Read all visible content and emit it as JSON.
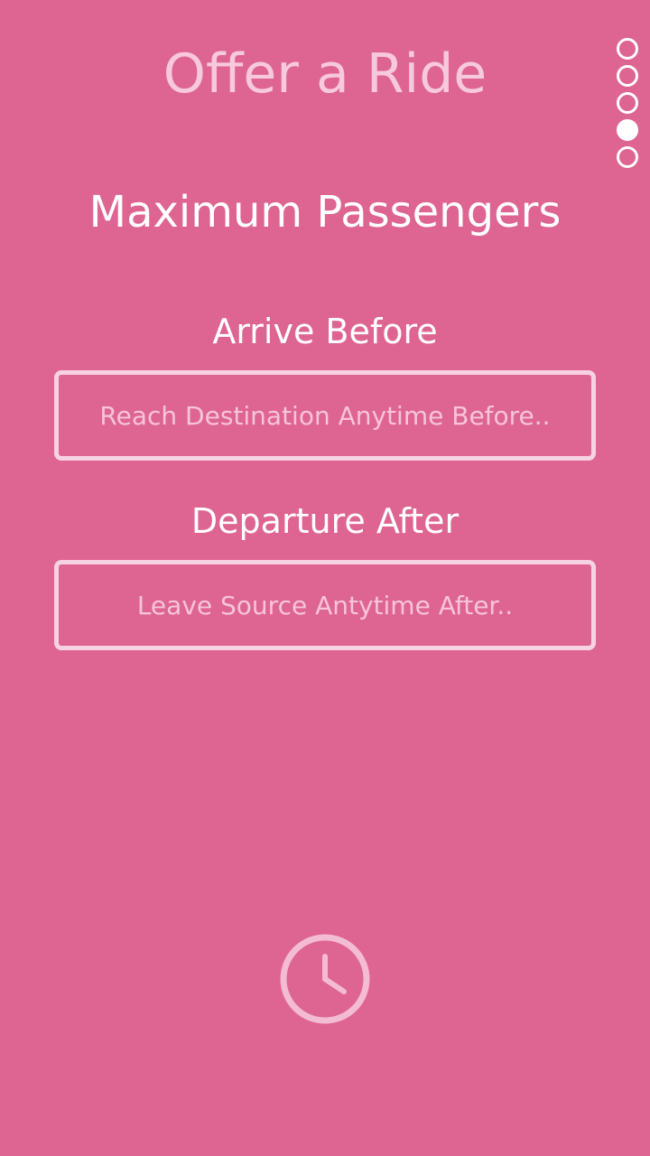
{
  "header": {
    "title": "Offer a Ride"
  },
  "pager": {
    "total": 5,
    "active_index": 3
  },
  "form": {
    "section_title": "Maximum Passengers",
    "arrive": {
      "label": "Arrive Before",
      "placeholder": "Reach Destination Anytime Before..",
      "value": ""
    },
    "depart": {
      "label": "Departure After",
      "placeholder": "Leave Source Antytime After..",
      "value": ""
    }
  },
  "icons": {
    "clock": "clock-icon"
  },
  "colors": {
    "background": "#de6491",
    "title_text": "#f7c9dc",
    "field_border": "#f7d2e1",
    "placeholder_text": "#f7c4da",
    "accent": "#ffffff"
  }
}
